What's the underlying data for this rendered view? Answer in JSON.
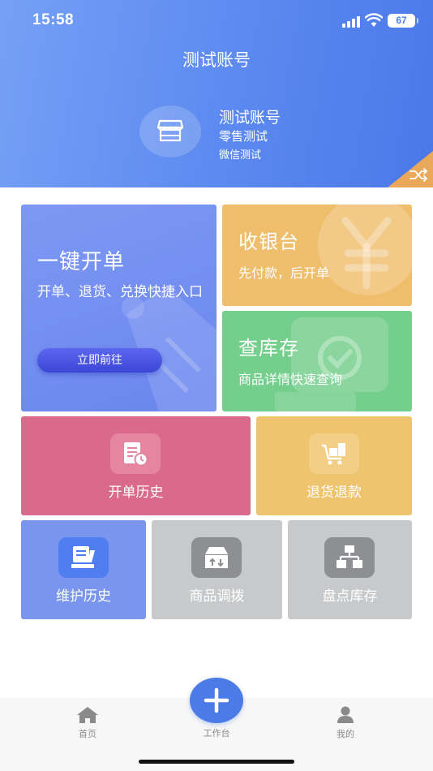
{
  "status_bar": {
    "time": "15:58",
    "battery": "67"
  },
  "header": {
    "title": "测试账号",
    "store": {
      "name": "测试账号",
      "subtitle_1": "零售测试",
      "subtitle_2": "微信测试"
    },
    "icons": {
      "store": "store-icon",
      "switch": "shuffle-icon"
    }
  },
  "tiles": {
    "quick_order": {
      "title": "一键开单",
      "desc": "开单、退货、兑换快捷入口",
      "button": "立即前往"
    },
    "cashier": {
      "title": "收银台",
      "desc": "先付款，后开单"
    },
    "stock": {
      "title": "查库存",
      "desc": "商品详情快速查询"
    },
    "order_history": {
      "label": "开单历史",
      "icon": "document-clock-icon"
    },
    "return_refund": {
      "label": "退货退款",
      "icon": "cart-return-icon"
    },
    "maintenance_history": {
      "label": "维护历史",
      "icon": "edit-document-icon"
    },
    "product_transfer": {
      "label": "商品调拨",
      "icon": "transfer-box-icon"
    },
    "inventory_count": {
      "label": "盘点库存",
      "icon": "hierarchy-icon"
    }
  },
  "tabbar": {
    "home": "首页",
    "workbench": "工作台",
    "mine": "我的"
  },
  "colors": {
    "header_start": "#76a0f6",
    "header_end": "#4a78e8",
    "quick_order": "#7d98f3",
    "cashier": "#efbe6c",
    "stock": "#74cf8c",
    "order_history": "#d96a8c",
    "return_refund": "#eec46f",
    "maintenance_history": "#7a95ed",
    "disabled": "#c7c9cb",
    "fab": "#4b7be6"
  }
}
